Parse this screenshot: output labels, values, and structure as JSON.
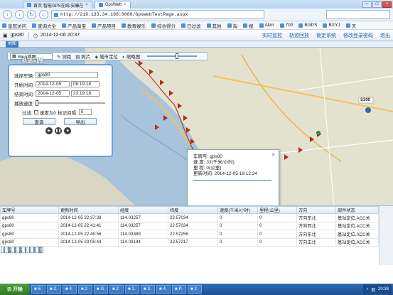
{
  "browser": {
    "tabs": [
      {
        "label": "首页-智能GPS在线/安康在"
      },
      {
        "label": "GpsWeb"
      }
    ],
    "url": "http://219.133.34.196:8086/GpsWebTestPage.aspx",
    "bookmarks": [
      "皇冠访问",
      "查询大全",
      "产品淘宝",
      "产品项目",
      "教育娱乐",
      "综合得分",
      "已过滤",
      "其他",
      "淘",
      "搜",
      "Akm",
      "700",
      "BGPS",
      "BXYJ",
      "天"
    ]
  },
  "app": {
    "vehicle": "gps80",
    "datetime": "2014-12-06 20:37",
    "links": [
      "实时监控",
      "轨迹回放",
      "锁定系统",
      "修改登录密码",
      "退出"
    ]
  },
  "map": {
    "tab": "地图",
    "toolbar": {
      "map_type": "Bing地图",
      "tools": [
        "测距",
        "照片",
        "城市定位",
        "缩略图"
      ]
    },
    "labels": [
      "S300"
    ]
  },
  "playback": {
    "title": "轨迹回放",
    "vehicle_label": "选择车辆:",
    "vehicle_value": "gps80",
    "start_label": "开始时间:",
    "start_date": "2014-12-05",
    "start_time": "08:19:18",
    "end_label": "结束时间:",
    "end_date": "2014-12-05",
    "end_time": "23:19:18",
    "speed_label": "播放速度:",
    "filter_label": "过滤:",
    "filter_speed": "速度为0",
    "filter_mark": "标记间隔:",
    "filter_value": "5",
    "query": "查询",
    "export": "导出"
  },
  "popup": {
    "lines": [
      "车牌号: gps80",
      "速    度: 33(千米/小时)",
      "里    程: 0(公里)",
      "更新时间: 2014-12-05 16:12:34"
    ]
  },
  "table": {
    "headers": [
      "车牌号",
      "更新时间",
      "经度",
      "纬度",
      "速度(千米/小时)",
      "里程(公里)",
      "方向",
      "部件状态"
    ],
    "rows": [
      [
        "gps80",
        "2014-12-05 22:37:39",
        "114.03257",
        "22.57034",
        "0",
        "0",
        "方向东北",
        "基站定位,ACC关"
      ],
      [
        "gps80",
        "2014-12-05 22:41:41",
        "114.03257",
        "22.57034",
        "0",
        "0",
        "方向西北",
        "基站定位,ACC关"
      ],
      [
        "gps80",
        "2014-12-05 22:45:56",
        "114.03389",
        "22.57256",
        "0",
        "0",
        "方向东北",
        "基站定位,ACC关"
      ],
      [
        "gps80",
        "2014-12-05 23:05:44",
        "114.03194",
        "22.57217",
        "0",
        "0",
        "方向正北",
        "基站定位,ACC关"
      ],
      [
        "gps80",
        "2014-12-05 23:16:09",
        "114.03194",
        "22.57217",
        "0",
        "0",
        "方向正北",
        "基站定位,ACC关"
      ]
    ],
    "selected_index": 4
  },
  "taskbar": {
    "start": "开始",
    "tasks": [
      "6.",
      "2.",
      "4.",
      "2",
      "G.",
      "2",
      "2.",
      "3.",
      "4.",
      "P.",
      "2"
    ],
    "clock": "20:38"
  }
}
